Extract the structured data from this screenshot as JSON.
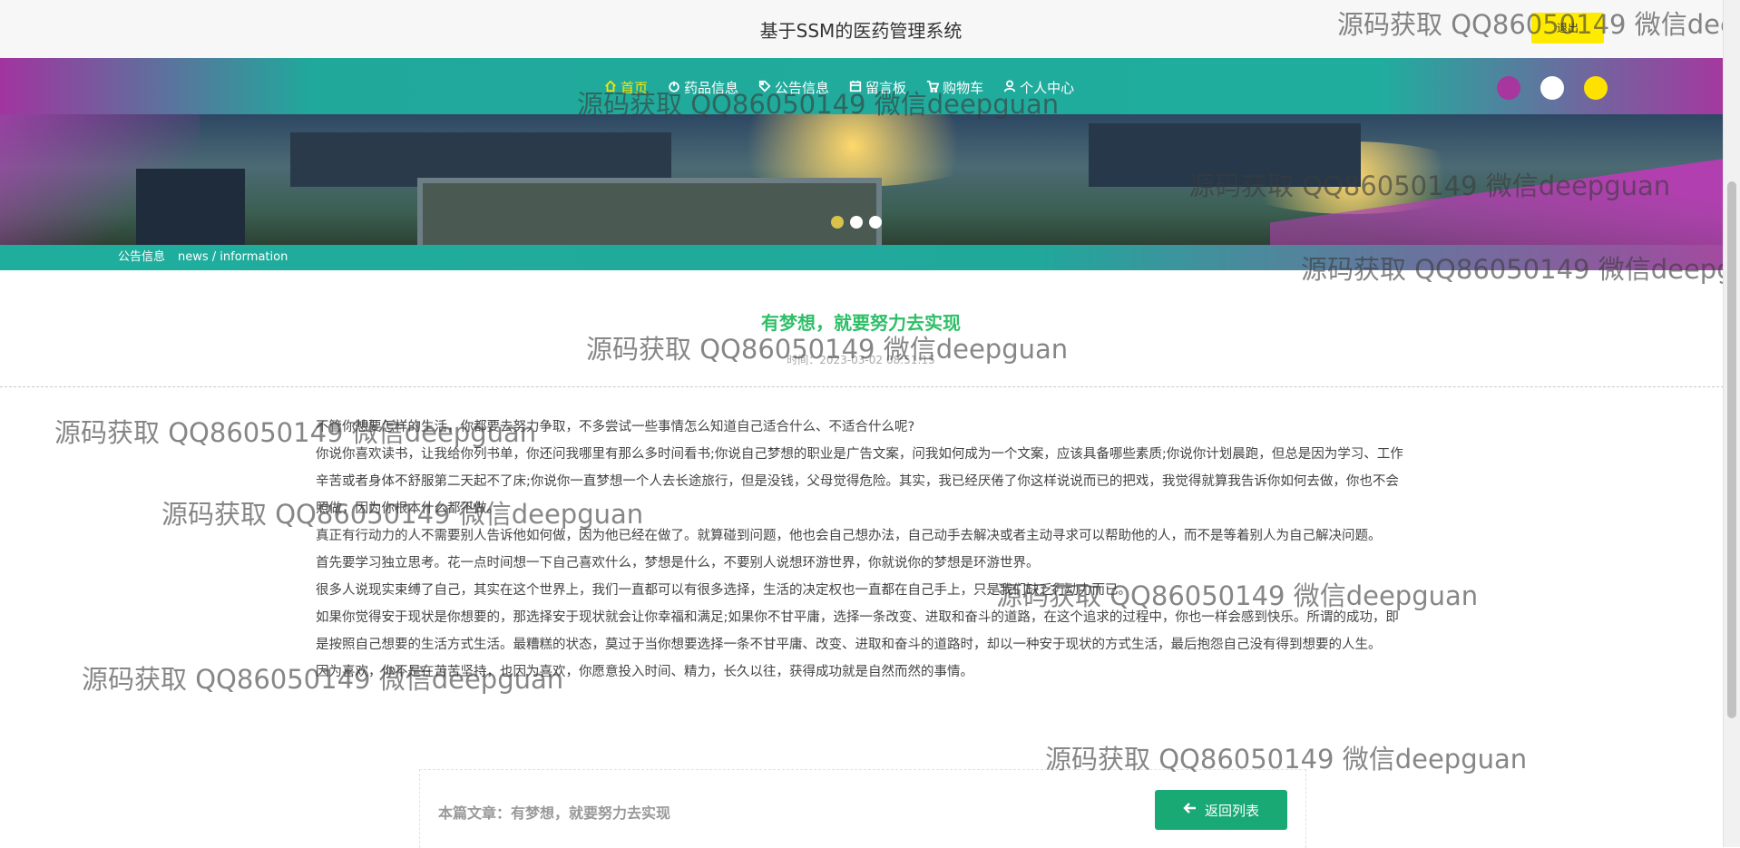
{
  "header": {
    "title": "基于SSM的医药管理系统",
    "logout_label": "退出"
  },
  "nav": {
    "items": [
      {
        "label": "首页",
        "icon": "home-icon",
        "active": true
      },
      {
        "label": "药品信息",
        "icon": "power-icon"
      },
      {
        "label": "公告信息",
        "icon": "tag-icon"
      },
      {
        "label": "留言板",
        "icon": "calendar-icon"
      },
      {
        "label": "购物车",
        "icon": "cart-icon"
      },
      {
        "label": "个人中心",
        "icon": "user-icon"
      }
    ],
    "theme_colors": [
      "#a7369e",
      "#ffffff",
      "#ffe100"
    ],
    "accent": "#1fae9e",
    "active_color": "#ffe600"
  },
  "banner": {
    "slide_count": 3,
    "active_slide": 1
  },
  "subnav": {
    "title": "公告信息",
    "english": "news / information"
  },
  "article": {
    "title": "有梦想，就要努力去实现",
    "time": "时间：2023-03-02 08:51:15",
    "paragraphs": [
      "不管你想要怎样的生活，你都要去努力争取，不多尝试一些事情怎么知道自己适合什么、不适合什么呢?",
      "你说你喜欢读书，让我给你列书单，你还问我哪里有那么多时间看书;你说自己梦想的职业是广告文案，问我如何成为一个文案，应该具备哪些素质;你说你计划晨跑，但总是因为学习、工作辛苦或者身体不舒服第二天起不了床;你说你一直梦想一个人去长途旅行，但是没钱，父母觉得危险。其实，我已经厌倦了你这样说说而已的把戏，我觉得就算我告诉你如何去做，你也不会照做，因为你根本什么都不做。",
      "真正有行动力的人不需要别人告诉他如何做，因为他已经在做了。就算碰到问题，他也会自己想办法，自己动手去解决或者主动寻求可以帮助他的人，而不是等着别人为自己解决问题。",
      "首先要学习独立思考。花一点时间想一下自己喜欢什么，梦想是什么，不要别人说想环游世界，你就说你的梦想是环游世界。",
      "很多人说现实束缚了自己，其实在这个世界上，我们一直都可以有很多选择，生活的决定权也一直都在自己手上，只是我们缺乏行动力而已。",
      "如果你觉得安于现状是你想要的，那选择安于现状就会让你幸福和满足;如果你不甘平庸，选择一条改变、进取和奋斗的道路，在这个追求的过程中，你也一样会感到快乐。所谓的成功，即是按照自己想要的生活方式生活。最糟糕的状态，莫过于当你想要选择一条不甘平庸、改变、进取和奋斗的道路时，却以一种安于现状的方式生活，最后抱怨自己没有得到想要的人生。",
      "因为喜欢，你不是在苦苦坚持，也因为喜欢，你愿意投入时间、精力，长久以往，获得成功就是自然而然的事情。"
    ],
    "current_label": "本篇文章：有梦想，就要努力去实现",
    "back_label": "返回列表",
    "title_color": "#2fbf68",
    "button_color": "#19a974"
  },
  "watermarks": [
    "源码获取 QQ86050149 微信dee",
    "源码获取 QQ86050149 微信deepguan",
    "源码获取 QQ86050149 微信deepguan",
    "源码获取 QQ86050149 微信deepg",
    "源码获取 QQ86050149 微信deepguan",
    "源码获取 QQ86050149 微信deepguan",
    "源码获取 QQ86050149 微信deepguan",
    "源码获取 QQ86050149 微信deepguan",
    "源码获取 QQ86050149 微信deepguan",
    "源码获取 QQ86050149 微信deepguan"
  ]
}
